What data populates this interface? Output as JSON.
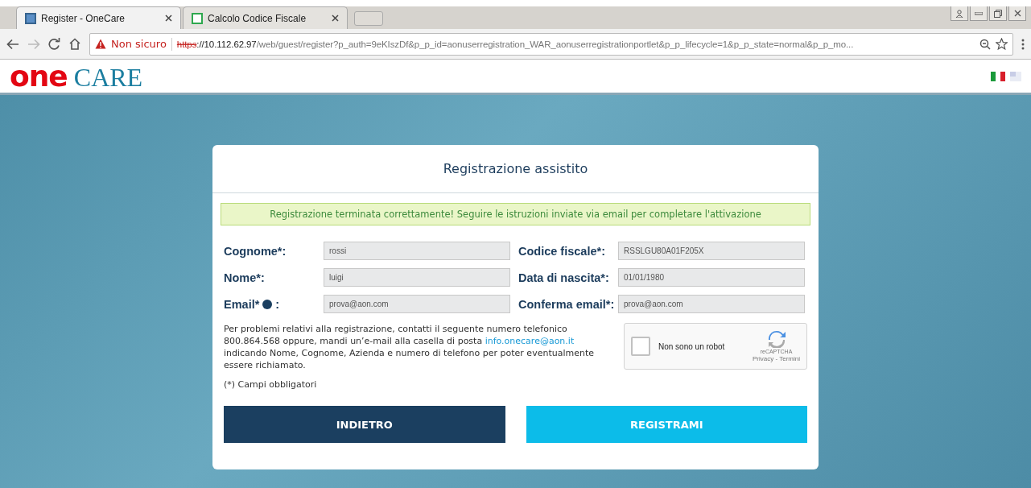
{
  "browser": {
    "tabs": [
      {
        "title": "Register - OneCare",
        "selected": true
      },
      {
        "title": "Calcolo Codice Fiscale",
        "selected": false
      }
    ],
    "security_label": "Non sicuro",
    "url_scheme": "https",
    "url_host": "://10.112.62.97",
    "url_path": "/web/guest/register?p_auth=9eKIszDf&p_p_id=aonuserregistration_WAR_aonuserregistrationportlet&p_p_lifecycle=1&p_p_state=normal&p_p_mo..."
  },
  "header": {
    "logo_one": "one",
    "logo_care": "CARE"
  },
  "card": {
    "title": "Registrazione assistito",
    "success_message": "Registrazione terminata correttamente! Seguire le istruzioni inviate via email per completare l'attivazione",
    "fields": [
      {
        "label": "Cognome*:",
        "value": "rossi",
        "has_info": false
      },
      {
        "label": "Codice fiscale*:",
        "value": "RSSLGU80A01F205X",
        "has_info": false
      },
      {
        "label": "Nome*:",
        "value": "luigi",
        "has_info": false
      },
      {
        "label": "Data di nascita*:",
        "value": "01/01/1980",
        "has_info": false
      },
      {
        "label": "Email*",
        "value": "prova@aon.com",
        "has_info": true,
        "suffix": ":"
      },
      {
        "label": "Conferma email*:",
        "value": "prova@aon.com",
        "has_info": false
      }
    ],
    "help_before": "Per problemi relativi alla registrazione, contatti il seguente numero telefonico 800.864.568 oppure, mandi un’e-mail alla casella di posta ",
    "help_link": "info.onecare@aon.it",
    "help_after": " indicando Nome, Cognome, Azienda e numero di telefono per poter eventualmente essere richiamato.",
    "required_note": "(*) Campi obbligatori",
    "captcha": {
      "label": "Non sono un robot",
      "checked": false,
      "brand": "reCAPTCHA",
      "links": "Privacy - Termini"
    },
    "buttons": [
      {
        "label": "INDIETRO",
        "kind": "secondary"
      },
      {
        "label": "REGISTRAMI",
        "kind": "primary"
      }
    ]
  }
}
